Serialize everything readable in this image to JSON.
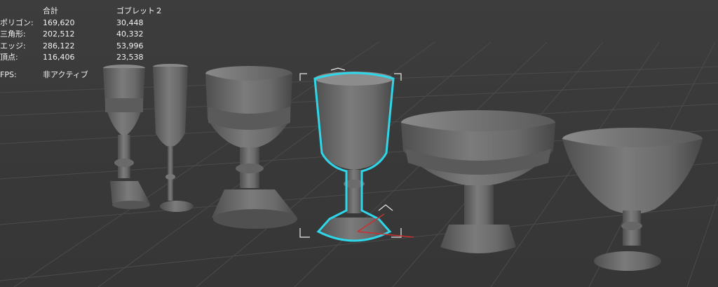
{
  "statistics": {
    "headers": {
      "total": "合計",
      "selection": "ゴブレット２"
    },
    "rows": [
      {
        "label": "ポリゴン:",
        "total": "169,620",
        "selection": "30,448"
      },
      {
        "label": "三角形:",
        "total": "202,512",
        "selection": "40,332"
      },
      {
        "label": "エッジ:",
        "total": "286,122",
        "selection": "53,996"
      },
      {
        "label": "頂点:",
        "total": "116,406",
        "selection": "23,538"
      }
    ],
    "fps": {
      "label": "FPS:",
      "value": "非アクティブ"
    }
  },
  "colors": {
    "viewport_bg": "#3b3b3b",
    "grid_line": "#4a4a4a",
    "object_body": "#6e6e6e",
    "selection_outline": "#2fd6e8",
    "bounding_box": "#e6e6e6",
    "gizmo_x": "#c93030"
  }
}
